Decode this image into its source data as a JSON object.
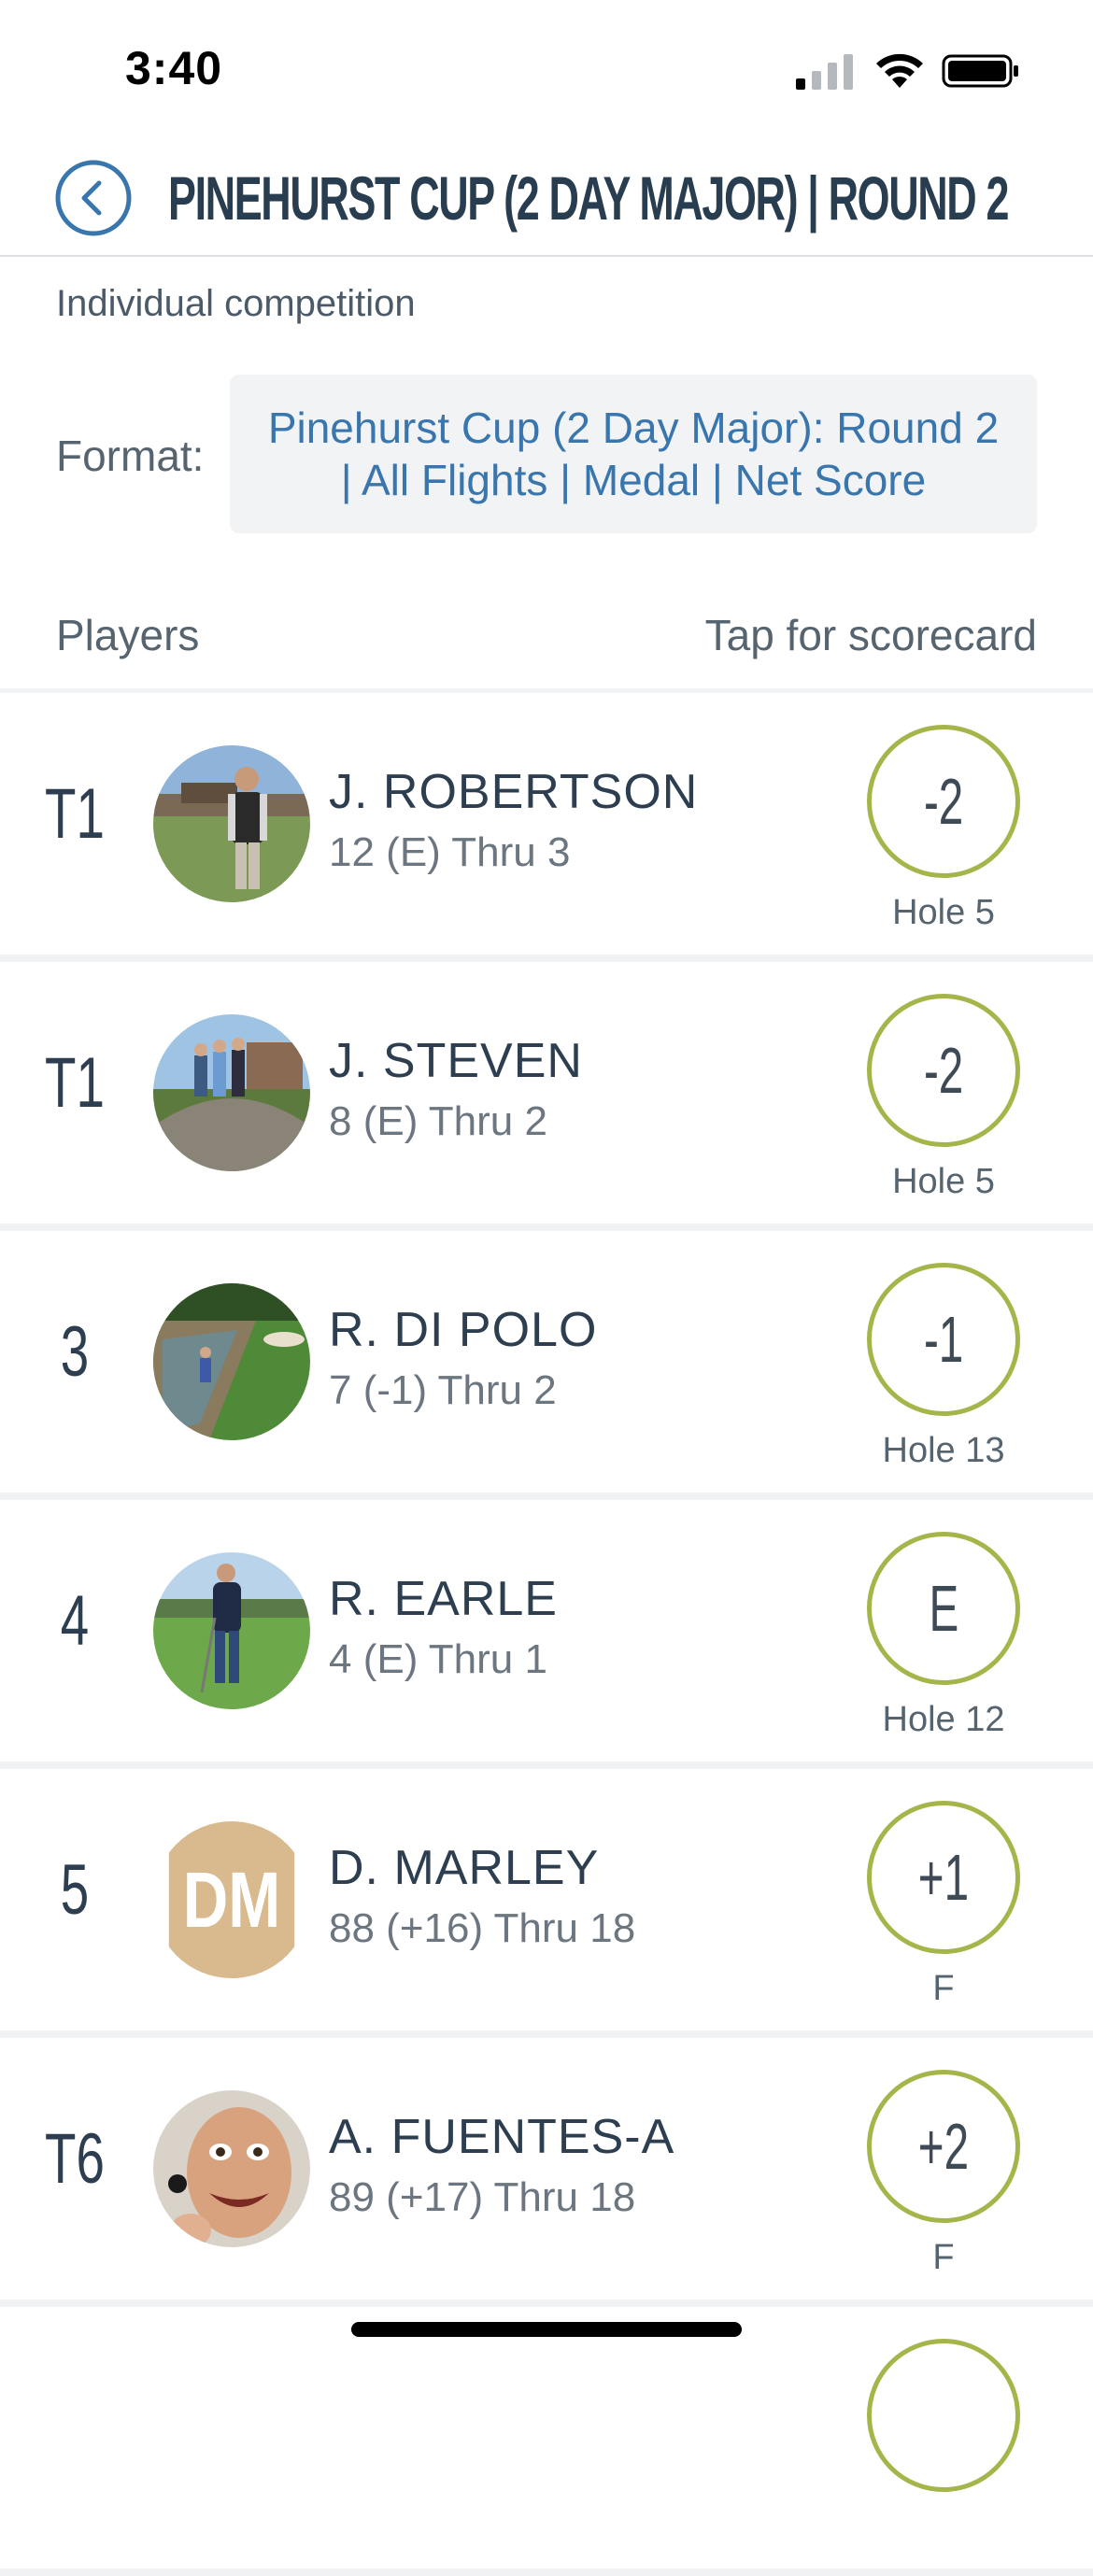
{
  "status_bar": {
    "time": "3:40"
  },
  "header": {
    "title": "PINEHURST CUP (2 DAY MAJOR) | ROUND 2"
  },
  "info": {
    "competition_type": "Individual competition",
    "format_label": "Format:",
    "format_value": "Pinehurst Cup (2 Day Major): Round 2 | All Flights | Medal | Net Score",
    "players_label": "Players",
    "tap_label": "Tap for scorecard"
  },
  "players": [
    {
      "rank": "T1",
      "name": "J. ROBERTSON",
      "detail": "12 (E) Thru 3",
      "score": "-2",
      "hole": "Hole 5",
      "avatar": "photo-golf-course"
    },
    {
      "rank": "T1",
      "name": "J. STEVEN",
      "detail": "8 (E) Thru 2",
      "score": "-2",
      "hole": "Hole 5",
      "avatar": "photo-bridge"
    },
    {
      "rank": "3",
      "name": "R. DI POLO",
      "detail": "7 (-1) Thru 2",
      "score": "-1",
      "hole": "Hole 13",
      "avatar": "photo-bunker"
    },
    {
      "rank": "4",
      "name": "R. EARLE",
      "detail": "4 (E) Thru 1",
      "score": "E",
      "hole": "Hole 12",
      "avatar": "photo-fairway"
    },
    {
      "rank": "5",
      "name": "D. MARLEY",
      "detail": "88 (+16) Thru 18",
      "score": "+1",
      "hole": "F",
      "avatar_initials": "DM"
    },
    {
      "rank": "T6",
      "name": "A. FUENTES-A",
      "detail": "89 (+17) Thru 18",
      "score": "+2",
      "hole": "F",
      "avatar": "photo-face"
    }
  ],
  "colors": {
    "score_ring": "#a6b54a",
    "link": "#3a76ae",
    "title": "#283d4f"
  }
}
